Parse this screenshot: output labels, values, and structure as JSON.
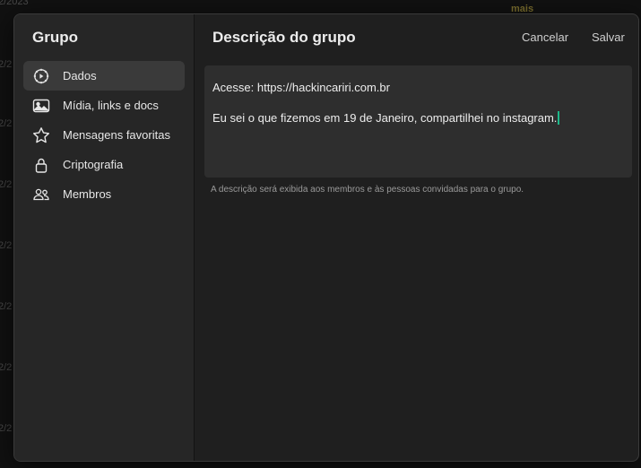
{
  "background": {
    "dates": [
      "2/2023",
      "2/2",
      "2/2",
      "2/2",
      "2/2",
      "2/2",
      "2/2",
      "2/2"
    ],
    "more_label": "mais"
  },
  "sidebar": {
    "title": "Grupo",
    "items": [
      {
        "label": "Dados",
        "icon": "gear-icon",
        "active": true
      },
      {
        "label": "Mídia, links e docs",
        "icon": "photo-icon",
        "active": false
      },
      {
        "label": "Mensagens favoritas",
        "icon": "star-icon",
        "active": false
      },
      {
        "label": "Criptografia",
        "icon": "lock-icon",
        "active": false
      },
      {
        "label": "Membros",
        "icon": "people-icon",
        "active": false
      }
    ]
  },
  "main": {
    "title": "Descrição do grupo",
    "cancel_label": "Cancelar",
    "save_label": "Salvar",
    "description": {
      "line1": "Acesse: https://hackincariri.com.br",
      "line2": "Eu sei o que fizemos em 19 de Janeiro, compartilhei no instagram."
    },
    "hint": "A descrição será exibida aos membros e às pessoas convidadas para o grupo."
  },
  "colors": {
    "accent_caret": "#1db88a",
    "modal_bg": "#1f1f1f",
    "sidebar_bg": "#262626",
    "active_item_bg": "#3a3a3a"
  }
}
